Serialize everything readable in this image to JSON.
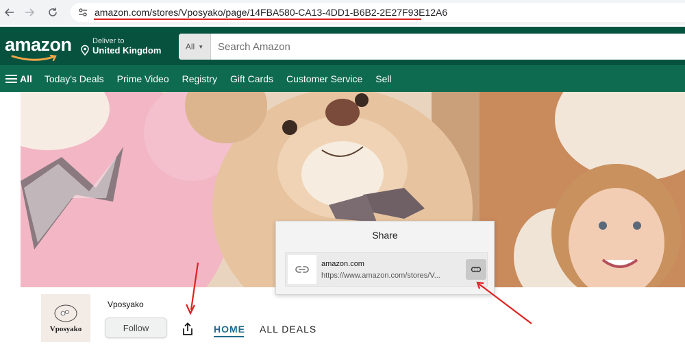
{
  "browser": {
    "url": "amazon.com/stores/Vposyako/page/14FBA580-CA13-4DD1-B6B2-2E27F93E12A6"
  },
  "header": {
    "logo_text": "amazon",
    "deliver_line1": "Deliver to",
    "deliver_line2": "United Kingdom",
    "search_category": "All",
    "search_placeholder": "Search Amazon"
  },
  "nav": {
    "all_label": "All",
    "items": [
      {
        "label": "Today's Deals"
      },
      {
        "label": "Prime Video"
      },
      {
        "label": "Registry"
      },
      {
        "label": "Gift Cards"
      },
      {
        "label": "Customer Service"
      },
      {
        "label": "Sell"
      }
    ]
  },
  "share_dialog": {
    "title": "Share",
    "site": "amazon.com",
    "url": "https://www.amazon.com/stores/V..."
  },
  "store": {
    "logo_text": "Vposyako",
    "name": "Vposyako",
    "follow_label": "Follow",
    "tabs": [
      {
        "label": "HOME",
        "active": true
      },
      {
        "label": "ALL DEALS",
        "active": false
      }
    ]
  },
  "colors": {
    "header_green": "#07523f",
    "nav_green": "#0f6b4f",
    "tab_active": "#1f6b8c",
    "annotation_red": "#e02020"
  },
  "icons": [
    "back-arrow-icon",
    "forward-arrow-icon",
    "reload-icon",
    "site-settings-icon",
    "location-pin-icon",
    "hamburger-icon",
    "link-icon",
    "copy-link-icon",
    "share-icon"
  ]
}
